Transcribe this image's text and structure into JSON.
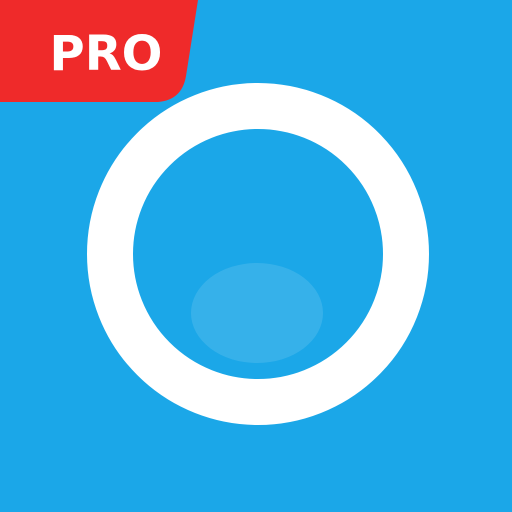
{
  "badge": {
    "label": "PRO"
  },
  "colors": {
    "background": "#1ba7e8",
    "ring": "#ffffff",
    "badge_background": "#ef2a2a",
    "badge_text": "#ffffff",
    "inner_highlight": "#ffffff"
  },
  "icons": {
    "ring": "ring-icon",
    "highlight": "inner-highlight-icon"
  }
}
